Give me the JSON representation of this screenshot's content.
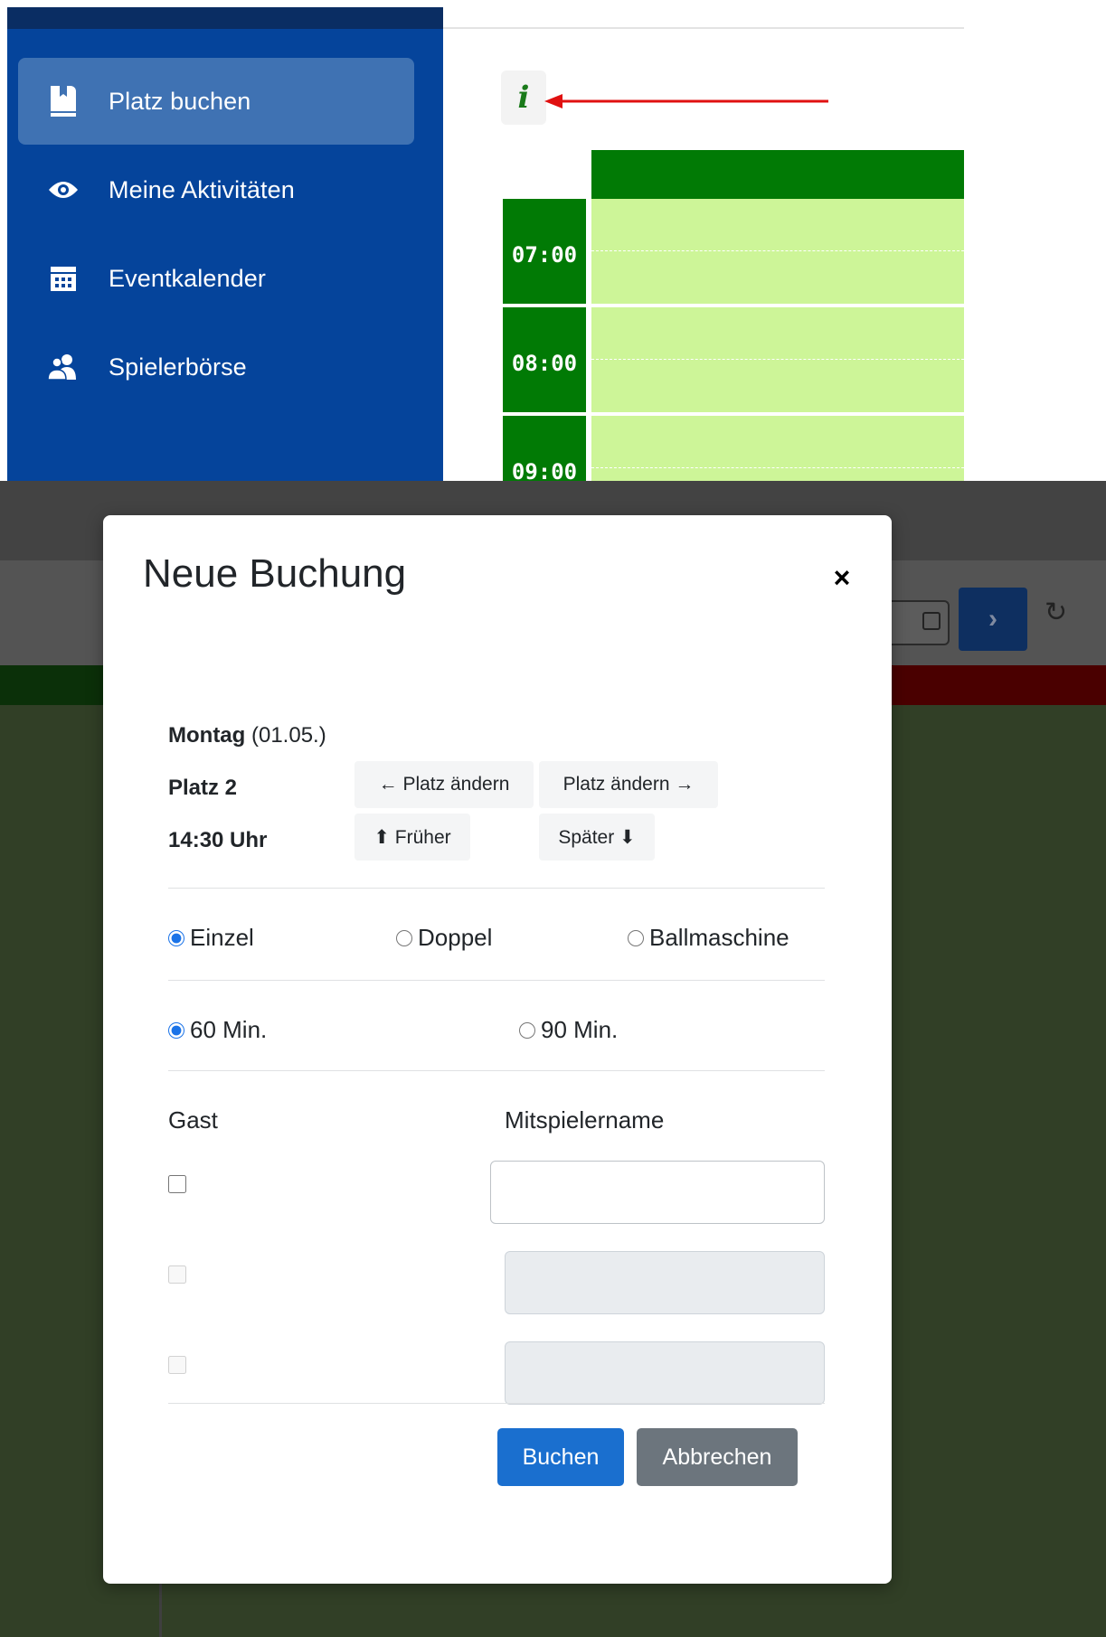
{
  "sidebar": {
    "items": [
      {
        "label": "Platz buchen",
        "icon": "book-icon",
        "active": true
      },
      {
        "label": "Meine Aktivitäten",
        "icon": "eye-icon",
        "active": false
      },
      {
        "label": "Eventkalender",
        "icon": "calendar-icon",
        "active": false
      },
      {
        "label": "Spielerbörse",
        "icon": "users-icon",
        "active": false
      }
    ]
  },
  "schedule": {
    "info_glyph": "i",
    "times": [
      "07:00",
      "08:00",
      "09:00"
    ]
  },
  "modal": {
    "title": "Neue Buchung",
    "close_glyph": "×",
    "day_name": "Montag",
    "day_date": "(01.05.)",
    "court": "Platz 2",
    "time": "14:30 Uhr",
    "court_prev_label": "← Platz ändern",
    "court_next_label": "Platz ändern →",
    "earlier_label": "⬆ Früher",
    "later_label": "Später ⬇",
    "play_types": [
      {
        "label": "Einzel",
        "checked": true
      },
      {
        "label": "Doppel",
        "checked": false
      },
      {
        "label": "Ballmaschine",
        "checked": false
      }
    ],
    "durations": [
      {
        "label": "60 Min.",
        "checked": true
      },
      {
        "label": "90 Min.",
        "checked": false
      }
    ],
    "guest_header": "Gast",
    "partner_header": "Mitspielername",
    "submit_label": "Buchen",
    "cancel_label": "Abbrechen"
  },
  "colors": {
    "sidebar_bg": "#05449b",
    "sidebar_active": "#3f72b3",
    "schedule_green": "#017a05",
    "slot_free": "#cdf598",
    "primary": "#1a6fcf",
    "secondary": "#6c757d"
  }
}
